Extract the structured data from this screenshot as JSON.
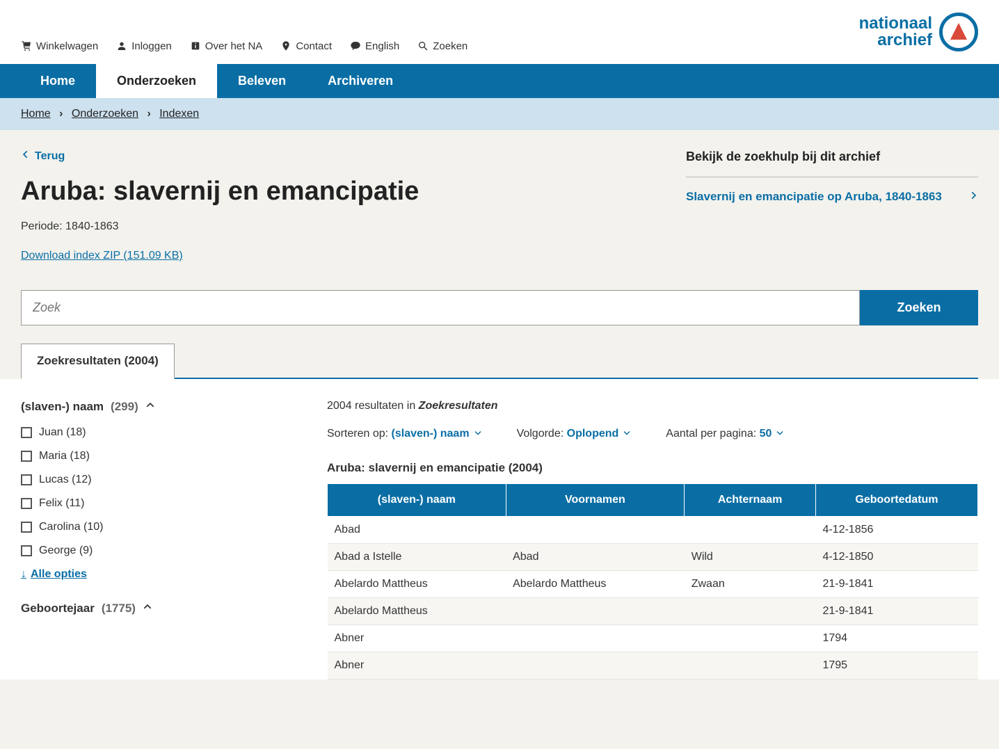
{
  "topLinks": {
    "cart": "Winkelwagen",
    "login": "Inloggen",
    "about": "Over het NA",
    "contact": "Contact",
    "english": "English",
    "search": "Zoeken"
  },
  "logo": {
    "line1": "nationaal",
    "line2": "archief"
  },
  "nav": {
    "home": "Home",
    "onderzoeken": "Onderzoeken",
    "beleven": "Beleven",
    "archiveren": "Archiveren"
  },
  "breadcrumb": {
    "home": "Home",
    "onderzoeken": "Onderzoeken",
    "indexen": "Indexen"
  },
  "back": "Terug",
  "title": "Aruba: slavernij en emancipatie",
  "period_label": "Periode:",
  "period_value": "1840-1863",
  "download": "Download index ZIP (151.09 KB)",
  "side": {
    "title": "Bekijk de zoekhulp bij dit archief",
    "link": "Slavernij en emancipatie op Aruba, 1840-1863"
  },
  "search": {
    "placeholder": "Zoek",
    "button": "Zoeken"
  },
  "tab": {
    "label": "Zoekresultaten",
    "count": "(2004)"
  },
  "facets": [
    {
      "title": "(slaven-) naam",
      "count": "(299)",
      "items": [
        {
          "label": "Juan",
          "count": "(18)"
        },
        {
          "label": "Maria",
          "count": "(18)"
        },
        {
          "label": "Lucas",
          "count": "(12)"
        },
        {
          "label": "Felix",
          "count": "(11)"
        },
        {
          "label": "Carolina",
          "count": "(10)"
        },
        {
          "label": "George",
          "count": "(9)"
        }
      ],
      "allOptions": "Alle opties"
    },
    {
      "title": "Geboortejaar",
      "count": "(1775)",
      "items": [],
      "allOptions": ""
    }
  ],
  "results": {
    "countLine": {
      "count": "2004",
      "text": "resultaten in",
      "target": "Zoekresultaten"
    },
    "sorting": {
      "sortLabel": "Sorteren op:",
      "sortValue": "(slaven-) naam",
      "orderLabel": "Volgorde:",
      "orderValue": "Oplopend",
      "perPageLabel": "Aantal per pagina:",
      "perPageValue": "50"
    },
    "tableTitle": "Aruba: slavernij en emancipatie (2004)",
    "columns": [
      "(slaven-) naam",
      "Voornamen",
      "Achternaam",
      "Geboortedatum"
    ],
    "rows": [
      [
        "Abad",
        "",
        "",
        "4-12-1856"
      ],
      [
        "Abad a Istelle",
        "Abad",
        "Wild",
        "4-12-1850"
      ],
      [
        "Abelardo Mattheus",
        "Abelardo Mattheus",
        "Zwaan",
        "21-9-1841"
      ],
      [
        "Abelardo Mattheus",
        "",
        "",
        "21-9-1841"
      ],
      [
        "Abner",
        "",
        "",
        "1794"
      ],
      [
        "Abner",
        "",
        "",
        "1795"
      ]
    ]
  }
}
